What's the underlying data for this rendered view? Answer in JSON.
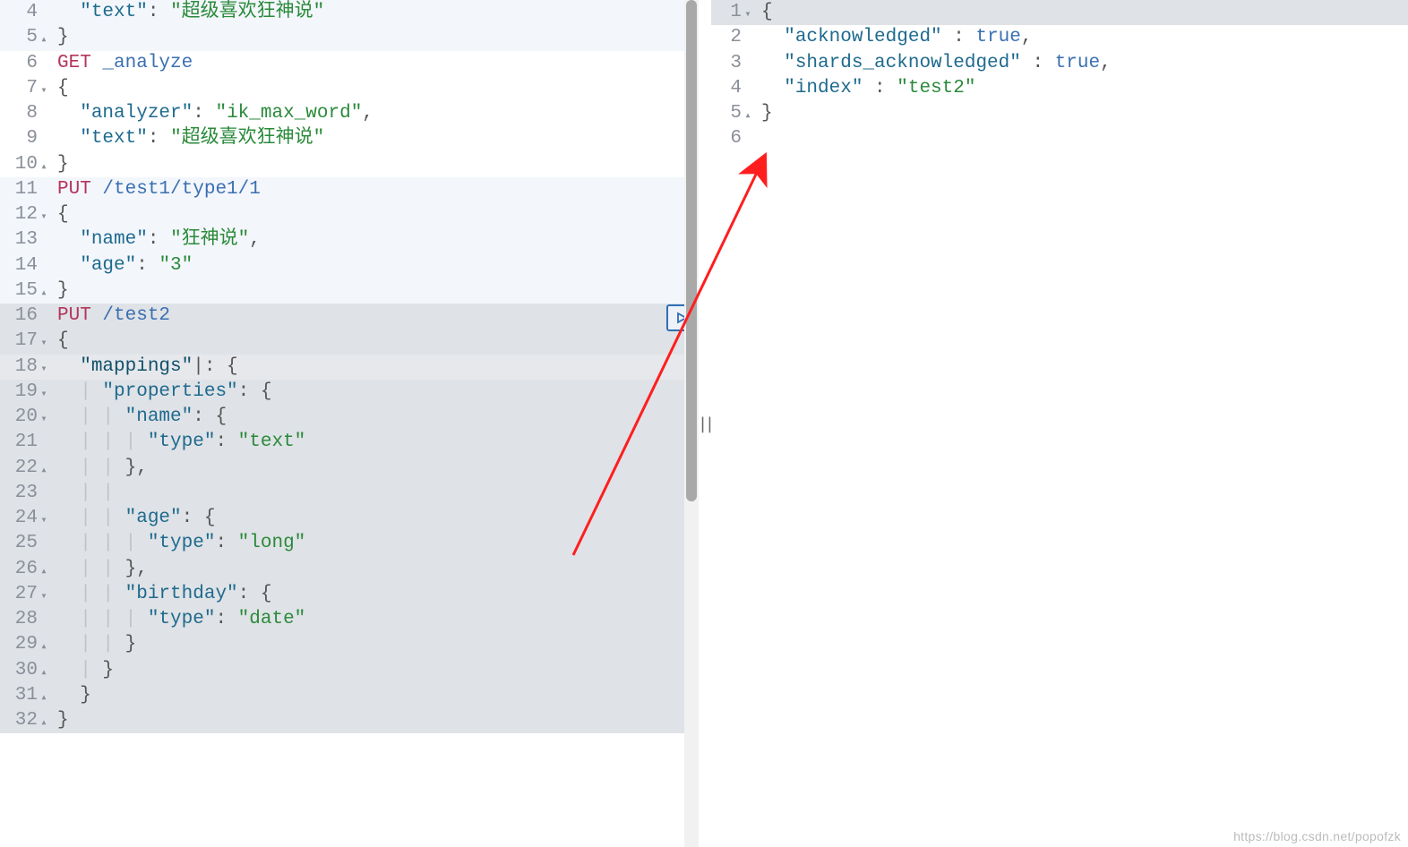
{
  "left": {
    "lines": [
      {
        "n": 4,
        "m": "",
        "bg": "alt",
        "tokens": [
          [
            "punc",
            "  "
          ],
          [
            "key",
            "\"text\""
          ],
          [
            "punc",
            ": "
          ],
          [
            "str",
            "\"超级喜欢狂神说\""
          ]
        ]
      },
      {
        "n": 5,
        "m": "▴",
        "bg": "alt",
        "tokens": [
          [
            "punc",
            "}"
          ]
        ]
      },
      {
        "n": 6,
        "m": "",
        "bg": "",
        "tokens": [
          [
            "method",
            "GET "
          ],
          [
            "path",
            "_analyze"
          ]
        ]
      },
      {
        "n": 7,
        "m": "▾",
        "bg": "",
        "tokens": [
          [
            "punc",
            "{"
          ]
        ]
      },
      {
        "n": 8,
        "m": "",
        "bg": "",
        "tokens": [
          [
            "punc",
            "  "
          ],
          [
            "key",
            "\"analyzer\""
          ],
          [
            "punc",
            ": "
          ],
          [
            "str",
            "\"ik_max_word\""
          ],
          [
            "punc",
            ","
          ]
        ]
      },
      {
        "n": 9,
        "m": "",
        "bg": "",
        "tokens": [
          [
            "punc",
            "  "
          ],
          [
            "key",
            "\"text\""
          ],
          [
            "punc",
            ": "
          ],
          [
            "str",
            "\"超级喜欢狂神说\""
          ]
        ]
      },
      {
        "n": 10,
        "m": "▴",
        "bg": "",
        "tokens": [
          [
            "punc",
            "}"
          ]
        ]
      },
      {
        "n": 11,
        "m": "",
        "bg": "alt",
        "tokens": [
          [
            "method",
            "PUT "
          ],
          [
            "path",
            "/test1/type1/1"
          ]
        ]
      },
      {
        "n": 12,
        "m": "▾",
        "bg": "alt",
        "tokens": [
          [
            "punc",
            "{"
          ]
        ]
      },
      {
        "n": 13,
        "m": "",
        "bg": "alt",
        "tokens": [
          [
            "punc",
            "  "
          ],
          [
            "key",
            "\"name\""
          ],
          [
            "punc",
            ": "
          ],
          [
            "str",
            "\"狂神说\""
          ],
          [
            "punc",
            ","
          ]
        ]
      },
      {
        "n": 14,
        "m": "",
        "bg": "alt",
        "tokens": [
          [
            "punc",
            "  "
          ],
          [
            "key",
            "\"age\""
          ],
          [
            "punc",
            ": "
          ],
          [
            "str",
            "\"3\""
          ]
        ]
      },
      {
        "n": 15,
        "m": "▴",
        "bg": "alt",
        "tokens": [
          [
            "punc",
            "}"
          ]
        ]
      },
      {
        "n": 16,
        "m": "",
        "bg": "active",
        "tokens": [
          [
            "method",
            "PUT "
          ],
          [
            "path",
            "/test2"
          ]
        ],
        "tools": true
      },
      {
        "n": 17,
        "m": "▾",
        "bg": "active",
        "tokens": [
          [
            "punc",
            "{"
          ]
        ]
      },
      {
        "n": 18,
        "m": "▾",
        "bg": "sel",
        "tokens": [
          [
            "punc",
            "  "
          ],
          [
            "key-dark",
            "\"mappings\""
          ],
          [
            "punc",
            "|: {"
          ]
        ]
      },
      {
        "n": 19,
        "m": "▾",
        "bg": "active",
        "tokens": [
          [
            "guide",
            "  | "
          ],
          [
            "key",
            "\"properties\""
          ],
          [
            "punc",
            ": {"
          ]
        ]
      },
      {
        "n": 20,
        "m": "▾",
        "bg": "active",
        "tokens": [
          [
            "guide",
            "  | | "
          ],
          [
            "key",
            "\"name\""
          ],
          [
            "punc",
            ": {"
          ]
        ]
      },
      {
        "n": 21,
        "m": "",
        "bg": "active",
        "tokens": [
          [
            "guide",
            "  | | | "
          ],
          [
            "key",
            "\"type\""
          ],
          [
            "punc",
            ": "
          ],
          [
            "str",
            "\"text\""
          ]
        ]
      },
      {
        "n": 22,
        "m": "▴",
        "bg": "active",
        "tokens": [
          [
            "guide",
            "  | | "
          ],
          [
            "punc",
            "},"
          ]
        ]
      },
      {
        "n": 23,
        "m": "",
        "bg": "active",
        "tokens": [
          [
            "guide",
            "  | | "
          ]
        ]
      },
      {
        "n": 24,
        "m": "▾",
        "bg": "active",
        "tokens": [
          [
            "guide",
            "  | | "
          ],
          [
            "key",
            "\"age\""
          ],
          [
            "punc",
            ": {"
          ]
        ]
      },
      {
        "n": 25,
        "m": "",
        "bg": "active",
        "tokens": [
          [
            "guide",
            "  | | | "
          ],
          [
            "key",
            "\"type\""
          ],
          [
            "punc",
            ": "
          ],
          [
            "str",
            "\"long\""
          ]
        ]
      },
      {
        "n": 26,
        "m": "▴",
        "bg": "active",
        "tokens": [
          [
            "guide",
            "  | | "
          ],
          [
            "punc",
            "},"
          ]
        ]
      },
      {
        "n": 27,
        "m": "▾",
        "bg": "active",
        "tokens": [
          [
            "guide",
            "  | | "
          ],
          [
            "key",
            "\"birthday\""
          ],
          [
            "punc",
            ": {"
          ]
        ]
      },
      {
        "n": 28,
        "m": "",
        "bg": "active",
        "tokens": [
          [
            "guide",
            "  | | | "
          ],
          [
            "key",
            "\"type\""
          ],
          [
            "punc",
            ": "
          ],
          [
            "str",
            "\"date\""
          ]
        ]
      },
      {
        "n": 29,
        "m": "▴",
        "bg": "active",
        "tokens": [
          [
            "guide",
            "  | | "
          ],
          [
            "punc",
            "}"
          ]
        ]
      },
      {
        "n": 30,
        "m": "▴",
        "bg": "active",
        "tokens": [
          [
            "guide",
            "  | "
          ],
          [
            "punc",
            "}"
          ]
        ]
      },
      {
        "n": 31,
        "m": "▴",
        "bg": "active",
        "tokens": [
          [
            "punc",
            "  }"
          ]
        ]
      },
      {
        "n": 32,
        "m": "▴",
        "bg": "active",
        "tokens": [
          [
            "punc",
            "}"
          ]
        ]
      }
    ]
  },
  "right": {
    "lines": [
      {
        "n": 1,
        "m": "▾",
        "bg": "active",
        "tokens": [
          [
            "punc",
            "{"
          ]
        ]
      },
      {
        "n": 2,
        "m": "",
        "bg": "",
        "tokens": [
          [
            "punc",
            "  "
          ],
          [
            "key",
            "\"acknowledged\""
          ],
          [
            "punc",
            " : "
          ],
          [
            "bool",
            "true"
          ],
          [
            "punc",
            ","
          ]
        ]
      },
      {
        "n": 3,
        "m": "",
        "bg": "",
        "tokens": [
          [
            "punc",
            "  "
          ],
          [
            "key",
            "\"shards_acknowledged\""
          ],
          [
            "punc",
            " : "
          ],
          [
            "bool",
            "true"
          ],
          [
            "punc",
            ","
          ]
        ]
      },
      {
        "n": 4,
        "m": "",
        "bg": "",
        "tokens": [
          [
            "punc",
            "  "
          ],
          [
            "key",
            "\"index\""
          ],
          [
            "punc",
            " : "
          ],
          [
            "str",
            "\"test2\""
          ]
        ]
      },
      {
        "n": 5,
        "m": "▴",
        "bg": "",
        "tokens": [
          [
            "punc",
            "}"
          ]
        ]
      },
      {
        "n": 6,
        "m": "",
        "bg": "",
        "tokens": []
      }
    ]
  },
  "watermark": "https://blog.csdn.net/popofzk"
}
